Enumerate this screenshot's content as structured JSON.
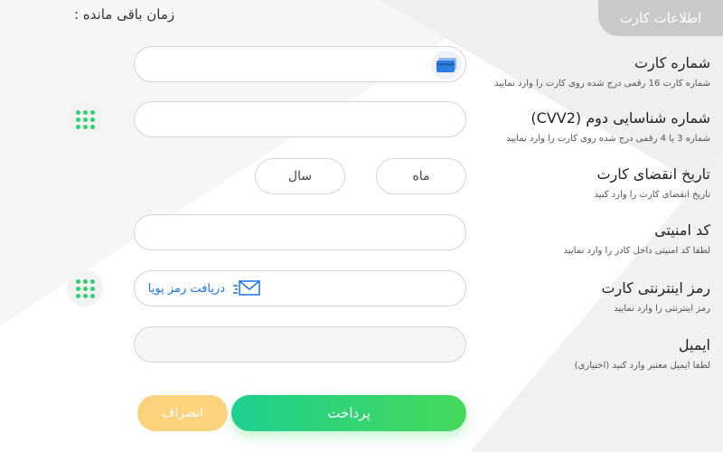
{
  "header": {
    "tab_label": "اطلاعات کارت",
    "timer_label": "زمان باقی مانده :"
  },
  "fields": [
    {
      "key": "card_number",
      "label": "شماره کارت",
      "hint": "شماره کارت 16 رقمی درج شده روی کارت را وارد نمایید",
      "value": "",
      "icon": "credit-card-icon"
    },
    {
      "key": "cvv2",
      "label": "شماره شناسایی دوم (CVV2)",
      "hint": "شماره 3 یا 4 رقمی درج شده روی کارت را وارد نمایید",
      "value": ""
    },
    {
      "key": "expiry",
      "label": "تاریخ انقضای کارت",
      "hint": "تاریخ انقضای کارت را وارد کنید",
      "month_placeholder": "ماه",
      "year_placeholder": "سال"
    },
    {
      "key": "security_code",
      "label": "کد امنیتی",
      "hint": "لطفا کد امنیتی داخل کادر را وارد نمایید",
      "value": ""
    },
    {
      "key": "internet_password",
      "label": "رمز اینترنتی کارت",
      "hint": "رمز اینترنتی را وارد نمایید",
      "value": "",
      "dynamic_password_label": "دریافت رمز پویا"
    },
    {
      "key": "email",
      "label": "ایمیل",
      "hint": "لطفا ایمیل معتبر وارد کنید (اختیاری)",
      "value": ""
    }
  ],
  "buttons": {
    "pay_label": "پرداخت",
    "cancel_label": "انصراف"
  },
  "colors": {
    "pay_gradient_start": "#1ecf8f",
    "pay_gradient_end": "#45d95a",
    "cancel": "#fcd27d",
    "keypad_dots": "#2fcf72",
    "link": "#1a73e8",
    "tab_bg": "#c9c9c9"
  }
}
